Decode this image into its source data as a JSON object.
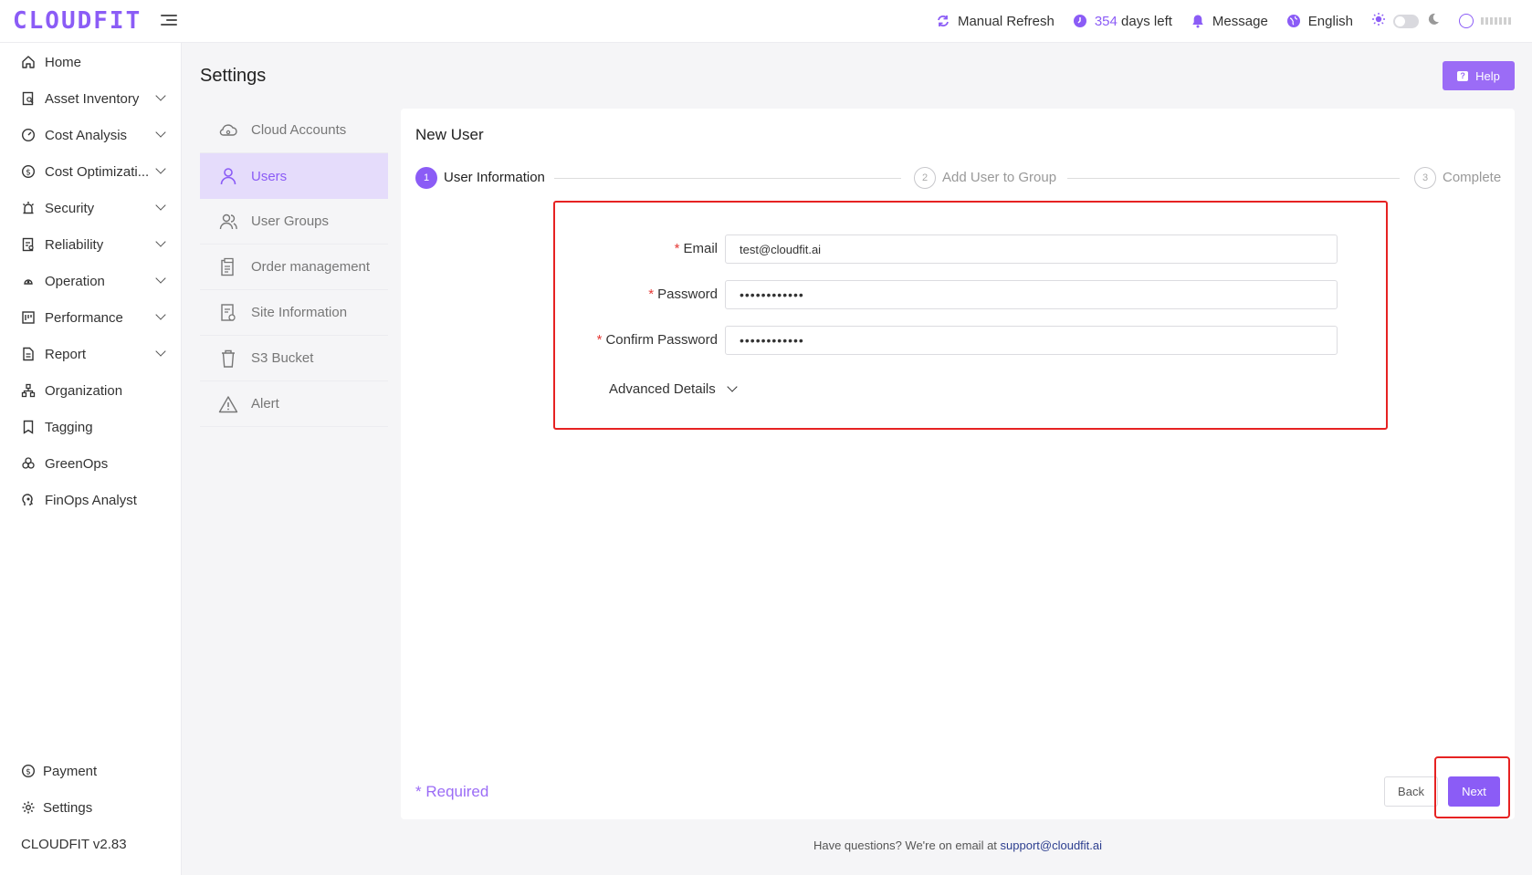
{
  "app": {
    "logo": "CLOUDFIT",
    "version": "CLOUDFIT v2.83"
  },
  "topbar": {
    "refresh_label": "Manual Refresh",
    "days_count": "354",
    "days_suffix": "days left",
    "message_label": "Message",
    "language_label": "English"
  },
  "sidebar": {
    "items": [
      {
        "label": "Home",
        "icon": "home-icon",
        "expandable": false
      },
      {
        "label": "Asset Inventory",
        "icon": "asset-inventory-icon",
        "expandable": true
      },
      {
        "label": "Cost Analysis",
        "icon": "cost-analysis-icon",
        "expandable": true
      },
      {
        "label": "Cost Optimizati...",
        "icon": "cost-optimization-icon",
        "expandable": true
      },
      {
        "label": "Security",
        "icon": "security-icon",
        "expandable": true
      },
      {
        "label": "Reliability",
        "icon": "reliability-icon",
        "expandable": true
      },
      {
        "label": "Operation",
        "icon": "operation-icon",
        "expandable": true
      },
      {
        "label": "Performance",
        "icon": "performance-icon",
        "expandable": true
      },
      {
        "label": "Report",
        "icon": "report-icon",
        "expandable": true
      },
      {
        "label": "Organization",
        "icon": "organization-icon",
        "expandable": false
      },
      {
        "label": "Tagging",
        "icon": "tagging-icon",
        "expandable": false
      },
      {
        "label": "GreenOps",
        "icon": "greenops-icon",
        "expandable": false
      },
      {
        "label": "FinOps Analyst",
        "icon": "finops-analyst-icon",
        "expandable": false
      }
    ],
    "bottom": [
      {
        "label": "Payment",
        "icon": "payment-icon"
      },
      {
        "label": "Settings",
        "icon": "settings-icon"
      }
    ]
  },
  "page": {
    "title": "Settings",
    "help_label": "Help"
  },
  "settings_menu": {
    "items": [
      {
        "label": "Cloud Accounts",
        "icon": "cloud-icon",
        "active": false
      },
      {
        "label": "Users",
        "icon": "user-icon",
        "active": true
      },
      {
        "label": "User Groups",
        "icon": "user-groups-icon",
        "active": false
      },
      {
        "label": "Order management",
        "icon": "clipboard-icon",
        "active": false
      },
      {
        "label": "Site Information",
        "icon": "site-info-icon",
        "active": false
      },
      {
        "label": "S3 Bucket",
        "icon": "bucket-icon",
        "active": false
      },
      {
        "label": "Alert",
        "icon": "warning-icon",
        "active": false
      }
    ]
  },
  "card": {
    "title": "New User",
    "steps": [
      {
        "number": "1",
        "label": "User Information",
        "active": true
      },
      {
        "number": "2",
        "label": "Add User to Group",
        "active": false
      },
      {
        "number": "3",
        "label": "Complete",
        "active": false
      }
    ],
    "form": {
      "email_label": "Email",
      "email_value": "test@cloudfit.ai",
      "password_label": "Password",
      "password_value": "••••••••••••",
      "confirm_label": "Confirm Password",
      "confirm_value": "••••••••••••",
      "required_mark": "*",
      "advanced_label": "Advanced Details"
    },
    "required_note": "* Required",
    "back_label": "Back",
    "next_label": "Next"
  },
  "footer": {
    "text": "Have questions? We're on email at",
    "email": "support@cloudfit.ai"
  },
  "colors": {
    "accent": "#8b5cf6",
    "highlight": "#e62222",
    "active_bg": "#e5dcfb"
  }
}
